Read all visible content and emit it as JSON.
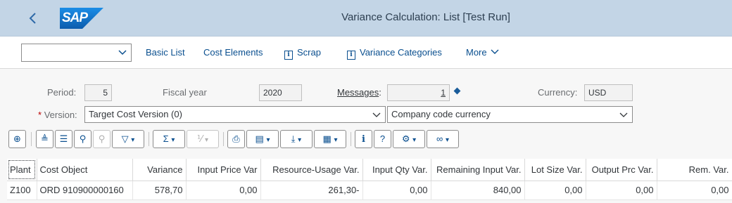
{
  "shell": {
    "title": "Variance Calculation: List [Test Run]",
    "logo_text": "SAP",
    "back_icon": "chevron-left-icon",
    "brand_color": "#1a73c7"
  },
  "toolbar": {
    "variant_value": "",
    "basic_list": "Basic List",
    "cost_elements": "Cost Elements",
    "scrap": "Scrap",
    "variance_categories": "Variance Categories",
    "more": "More"
  },
  "header": {
    "period_label": "Period:",
    "period_value": "5",
    "fiscal_year_label": "Fiscal year",
    "fiscal_year_value": "2020",
    "messages_label": "Messages",
    "messages_colon": ":",
    "messages_value": "1",
    "currency_label": "Currency:",
    "currency_value": "USD",
    "version_required": "*",
    "version_label": "Version:",
    "version_value": "Target Cost Version (0)",
    "currency_type_value": "Company code currency"
  },
  "grid": {
    "columns": [
      "Plant",
      "Cost Object",
      "Variance",
      "Input Price Var",
      "Resource-Usage Var.",
      "Input Qty Var.",
      "Remaining Input Var.",
      "Lot Size Var.",
      "Output Prc Var.",
      "Rem. Var."
    ],
    "rows": [
      [
        "Z100",
        "ORD 910900000160",
        "578,70",
        "0,00",
        "261,30-",
        "0,00",
        "840,00",
        "0,00",
        "0,00",
        "0,00"
      ]
    ]
  }
}
